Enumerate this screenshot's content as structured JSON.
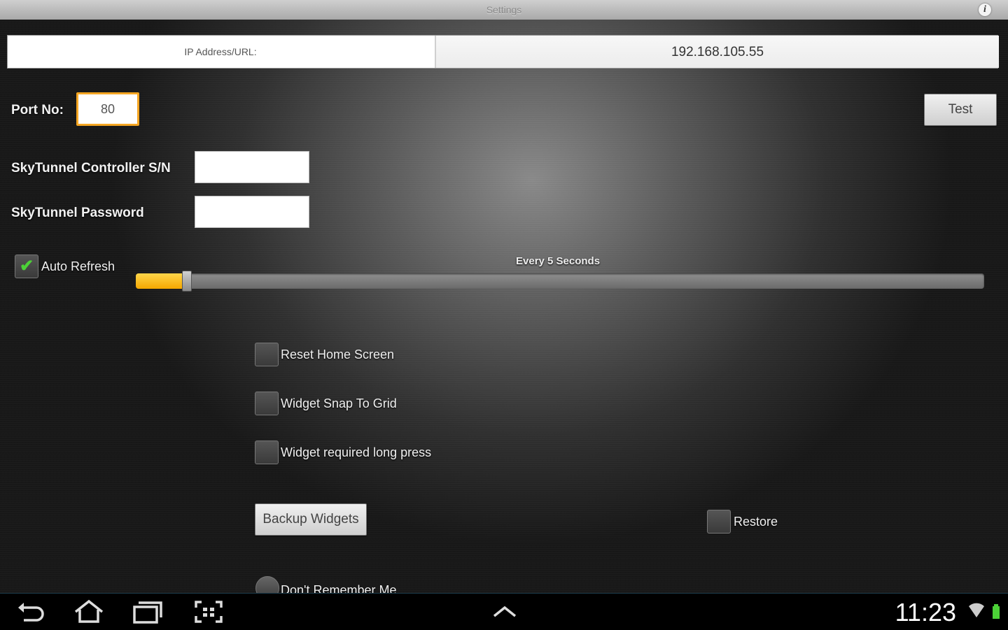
{
  "titlebar": {
    "title": "Settings",
    "info_icon": "info-icon"
  },
  "ip": {
    "label": "IP Address/URL:",
    "value": "192.168.105.55"
  },
  "port": {
    "label": "Port No:",
    "value": "80"
  },
  "test_button": "Test",
  "skytunnel": {
    "sn_label": "SkyTunnel Controller S/N",
    "sn_value": "",
    "password_label": "SkyTunnel Password",
    "password_value": ""
  },
  "auto_refresh": {
    "label": "Auto Refresh",
    "checked": true,
    "interval_caption": "Every 5 Seconds",
    "slider_fraction": 0.06
  },
  "options": [
    {
      "label": "Reset Home Screen",
      "checked": false
    },
    {
      "label": "Widget Snap To Grid",
      "checked": false
    },
    {
      "label": "Widget required long press",
      "checked": false
    }
  ],
  "backup_button": "Backup Widgets",
  "restore": {
    "label": "Restore",
    "checked": false
  },
  "remember": {
    "label": "Don't Remember Me"
  },
  "statusbar": {
    "time": "11:23"
  },
  "colors": {
    "accent_orange": "#f5a623",
    "slider_fill": "#ffc21f",
    "check_green": "#4cd137"
  }
}
